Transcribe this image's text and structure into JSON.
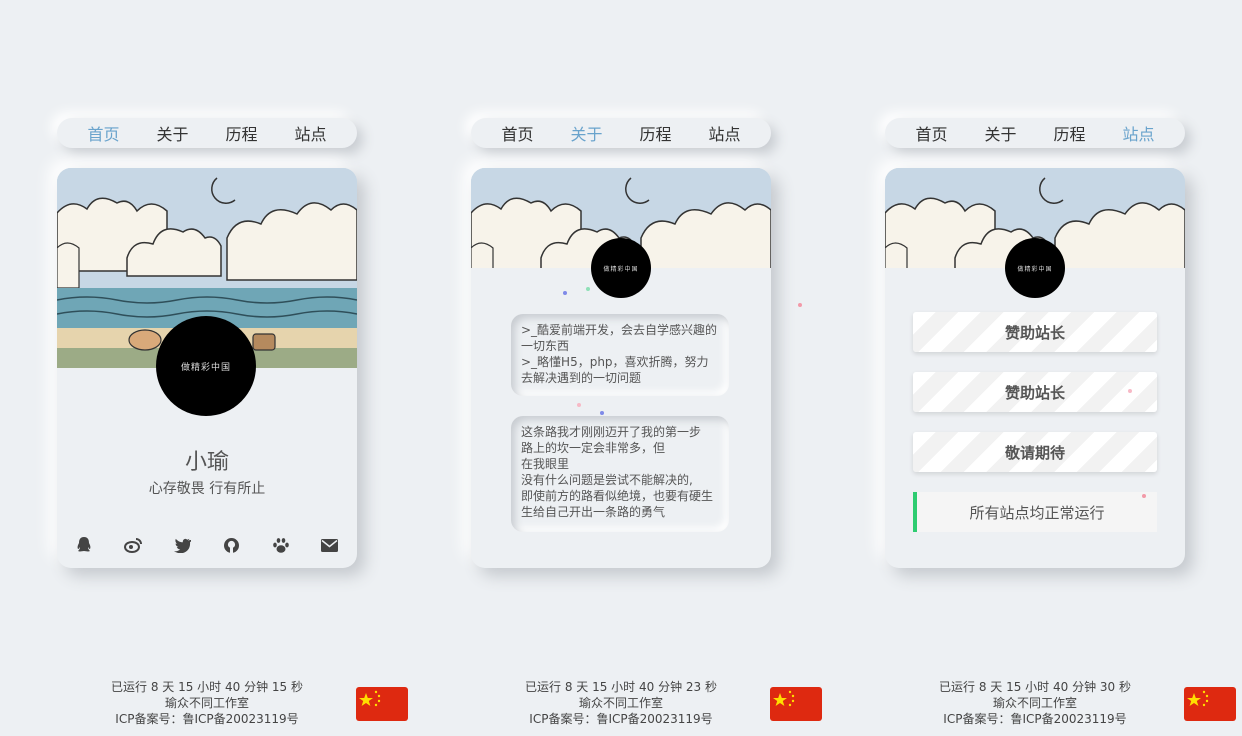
{
  "nav": {
    "items": [
      "首页",
      "关于",
      "历程",
      "站点"
    ]
  },
  "accent_color": "#69a3cc",
  "profile": {
    "avatar_text": "做精彩中国",
    "name": "小瑜",
    "motto": "心存敬畏 行有所止",
    "social_icons": [
      "qq-icon",
      "weibo-icon",
      "twitter-icon",
      "github-icon",
      "paw-icon",
      "mail-icon"
    ]
  },
  "about": {
    "box1_lines": [
      ">_酷爱前端开发，会去自学感兴趣的一切东西",
      ">_略懂H5，php，喜欢折腾，努力去解决遇到的一切问题"
    ],
    "box2_lines": [
      "这条路我才刚刚迈开了我的第一步",
      "路上的坎一定会非常多，但",
      "在我眼里",
      "没有什么问题是尝试不能解决的,",
      "即使前方的路看似绝境，也要有硬生生给自己开出一条路的勇气"
    ]
  },
  "sites": {
    "buttons": [
      "赞助站长",
      "赞助站长",
      "敬请期待"
    ],
    "status_text": "所有站点均正常运行",
    "status_color": "#2ecc71"
  },
  "footers": [
    {
      "runtime": "已运行 8 天 15 小时 40 分钟 15 秒",
      "studio": "瑜众不同工作室",
      "icp": "ICP备案号：鲁ICP备20023119号"
    },
    {
      "runtime": "已运行 8 天 15 小时 40 分钟 23 秒",
      "studio": "瑜众不同工作室",
      "icp": "ICP备案号：鲁ICP备20023119号"
    },
    {
      "runtime": "已运行 8 天 15 小时 40 分钟 30 秒",
      "studio": "瑜众不同工作室",
      "icp": "ICP备案号：鲁ICP备20023119号"
    }
  ]
}
